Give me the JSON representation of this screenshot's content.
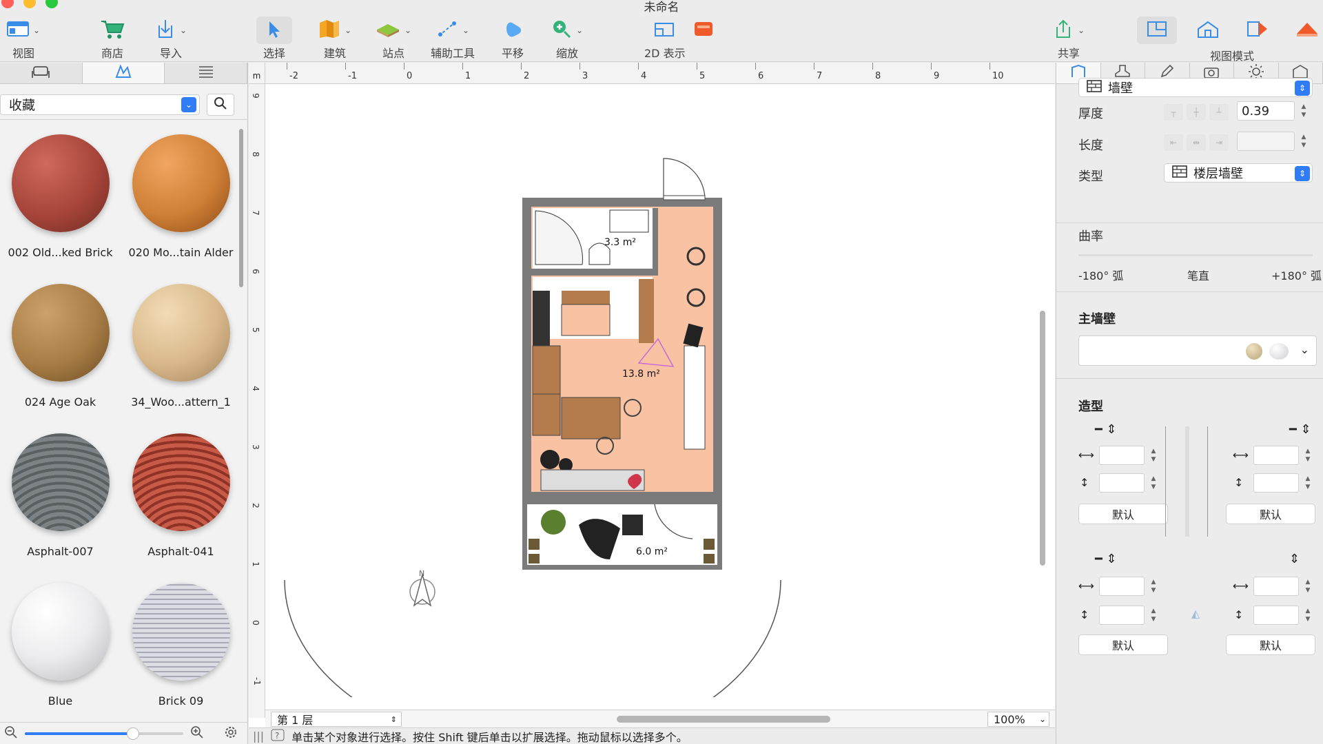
{
  "window": {
    "title": "未命名"
  },
  "toolbar": {
    "view_label": "视图",
    "store_label": "商店",
    "import_label": "导入",
    "select_label": "选择",
    "build_label": "建筑",
    "site_label": "站点",
    "helper_label": "辅助工具",
    "pan_label": "平移",
    "zoom_label": "缩放",
    "twod_label": "2D 表示",
    "share_label": "共享",
    "view_mode_label": "视图模式"
  },
  "library": {
    "selected": "收藏",
    "materials": [
      {
        "name": "002 Old...ked Brick",
        "color": "#a7453a"
      },
      {
        "name": "020 Mo...tain Alder",
        "color": "#cf7f36"
      },
      {
        "name": "024 Age Oak",
        "color": "#a87d45"
      },
      {
        "name": "34_Woo...attern_1",
        "color": "#d8b88a"
      },
      {
        "name": "Asphalt-007",
        "color": "#6d7376"
      },
      {
        "name": "Asphalt-041",
        "color": "#b24a3b"
      },
      {
        "name": "Blue",
        "color": "#e9e9eb"
      },
      {
        "name": "Brick 09",
        "color": "#c9c9d2"
      }
    ]
  },
  "canvas": {
    "unit": "m",
    "x_ticks": [
      "-2",
      "-1",
      "0",
      "1",
      "2",
      "3",
      "4",
      "5",
      "6",
      "7",
      "8",
      "9",
      "10"
    ],
    "y_ticks": [
      "9",
      "8",
      "7",
      "6",
      "5",
      "4",
      "3",
      "2",
      "1",
      "0",
      "-1"
    ],
    "room_bath_area": "3.3 m²",
    "room_main_area": "13.8 m²",
    "room_balcony_area": "6.0 m²",
    "compass_label": "N",
    "floor": "第 1 层",
    "zoom": "100%"
  },
  "status": {
    "hint": "单击某个对象进行选择。按住 Shift 键后单击以扩展选择。拖动鼠标以选择多个。"
  },
  "inspector": {
    "object_type": "墙壁",
    "thickness_label": "厚度",
    "thickness_value": "0.39",
    "length_label": "长度",
    "length_value": "",
    "type_label": "类型",
    "type_value": "楼层墙壁",
    "curvature_label": "曲率",
    "curve_left": "-180° 弧",
    "curve_mid": "笔直",
    "curve_right": "+180° 弧",
    "main_wall_label": "主墙壁",
    "shape_label": "造型",
    "default_btn": "默认"
  },
  "colors": {
    "accent": "#2f7cf6",
    "floor_main": "#f9c2a3",
    "wall": "#7b7b7b",
    "wood": "#b47b4d"
  }
}
